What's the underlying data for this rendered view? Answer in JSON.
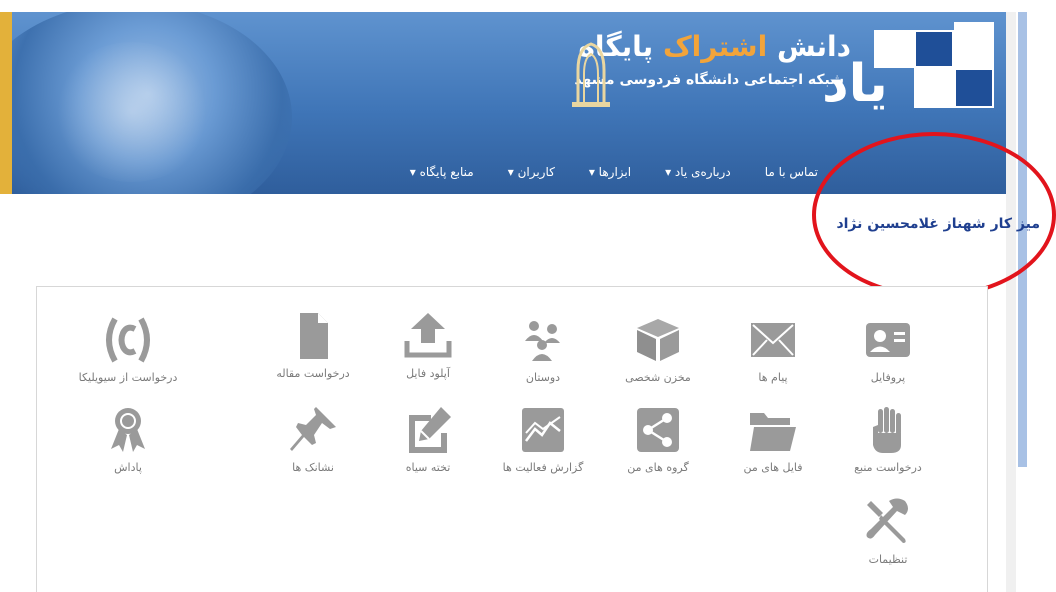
{
  "header": {
    "logo_mark": "یاد",
    "title_part1": "پایگاه",
    "title_part2": "اشتراک",
    "title_part3": "دانش",
    "subtitle": "شبکه اجتماعی دانشگاه فردوسی مشهد"
  },
  "nav": {
    "items": [
      {
        "label": "منابع پایگاه ▾"
      },
      {
        "label": "کاربران ▾"
      },
      {
        "label": "ابزارها ▾"
      },
      {
        "label": "درباره‌ی یاد ▾"
      },
      {
        "label": "تماس با ما"
      }
    ]
  },
  "desk": {
    "title": "میز کار شهناز غلامحسین نژاد"
  },
  "colors": {
    "header_blue": "#3f75b7",
    "icon_gray": "#9a9a9a",
    "highlight_red": "#e2141c",
    "title_orange": "#f2a43a"
  },
  "tiles": [
    {
      "label": "پروفایل",
      "icon": "profile-card-icon"
    },
    {
      "label": "پیام ها",
      "icon": "envelope-icon"
    },
    {
      "label": "مخزن شخصی",
      "icon": "box-icon"
    },
    {
      "label": "دوستان",
      "icon": "friends-icon"
    },
    {
      "label": "آپلود فایل",
      "icon": "upload-icon"
    },
    {
      "label": "درخواست مقاله",
      "icon": "document-icon"
    },
    {
      "label": "درخواست از سیویلیکا",
      "icon": "civilica-icon"
    },
    {
      "label": "درخواست منبع",
      "icon": "hand-icon"
    },
    {
      "label": "فایل های من",
      "icon": "folder-icon"
    },
    {
      "label": "گروه های من",
      "icon": "share-icon"
    },
    {
      "label": "گزارش فعالیت ها",
      "icon": "activity-chart-icon"
    },
    {
      "label": "تخته سیاه",
      "icon": "pencil-board-icon"
    },
    {
      "label": "نشانک ها",
      "icon": "pin-icon"
    },
    {
      "label": "پاداش",
      "icon": "award-icon"
    },
    {
      "label": "تنظیمات",
      "icon": "tools-icon"
    }
  ]
}
